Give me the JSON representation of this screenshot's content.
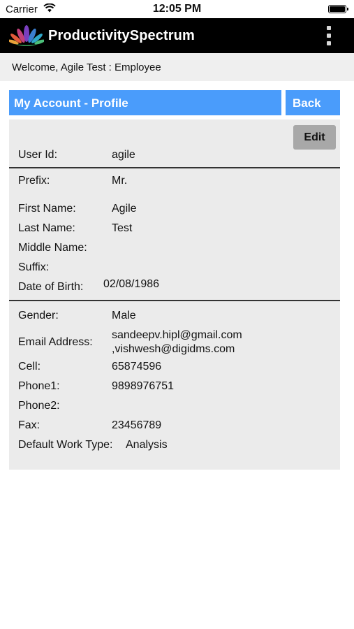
{
  "status_bar": {
    "carrier": "Carrier",
    "time": "12:05 PM"
  },
  "header": {
    "app_title": "ProductivitySpectrum",
    "logo_icon": "lotus-logo-icon",
    "menu_icon": "vertical-dots-menu-icon"
  },
  "welcome": {
    "text": "Welcome, Agile Test : Employee"
  },
  "page": {
    "title": "My Account - Profile",
    "back_label": "Back",
    "edit_label": "Edit"
  },
  "profile": {
    "user_id": {
      "label": "User Id:",
      "value": "agile"
    },
    "prefix": {
      "label": "Prefix:",
      "value": "Mr."
    },
    "first_name": {
      "label": "First Name:",
      "value": "Agile"
    },
    "last_name": {
      "label": "Last Name:",
      "value": "Test"
    },
    "middle_name": {
      "label": "Middle Name:",
      "value": ""
    },
    "suffix": {
      "label": "Suffix:",
      "value": ""
    },
    "dob": {
      "label": "Date of Birth:",
      "value": "02/08/1986"
    },
    "gender": {
      "label": "Gender:",
      "value": "Male"
    },
    "email": {
      "label": "Email Address:",
      "value_line1": "sandeepv.hipl@gmail.com",
      "value_line2": ",vishwesh@digidms.com"
    },
    "cell": {
      "label": "Cell:",
      "value": "65874596"
    },
    "phone1": {
      "label": "Phone1:",
      "value": "9898976751"
    },
    "phone2": {
      "label": "Phone2:",
      "value": ""
    },
    "fax": {
      "label": "Fax:",
      "value": "23456789"
    },
    "work_type": {
      "label": "Default Work Type:",
      "value": "Analysis"
    }
  },
  "colors": {
    "accent_blue": "#4a9cfb",
    "header_bg": "#000000",
    "panel_bg": "#ebebeb",
    "edit_button_bg": "#a8a8a8"
  }
}
